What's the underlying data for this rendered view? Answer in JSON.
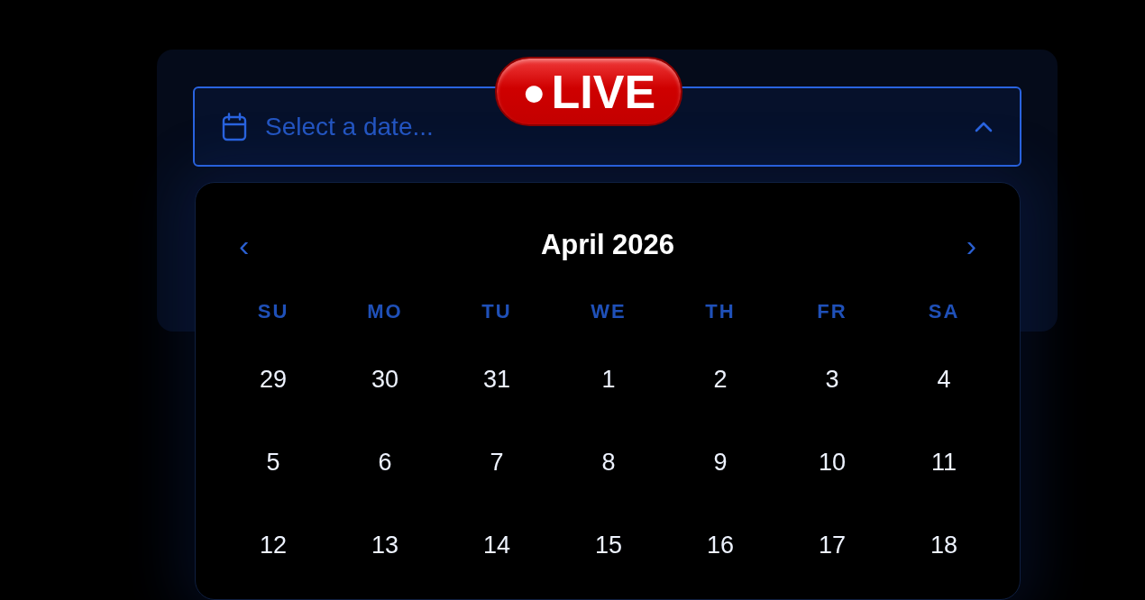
{
  "date_field": {
    "placeholder": "Select a date...",
    "expanded": true
  },
  "badge": {
    "dot": "●",
    "label": "LIVE"
  },
  "calendar": {
    "prev": "‹",
    "title": "April 2026",
    "next": "›",
    "weekdays": [
      "SU",
      "MO",
      "TU",
      "WE",
      "TH",
      "FR",
      "SA"
    ],
    "weeks": [
      [
        "29",
        "30",
        "31",
        "1",
        "2",
        "3",
        "4"
      ],
      [
        "5",
        "6",
        "7",
        "8",
        "9",
        "10",
        "11"
      ],
      [
        "12",
        "13",
        "14",
        "15",
        "16",
        "17",
        "18"
      ]
    ]
  }
}
